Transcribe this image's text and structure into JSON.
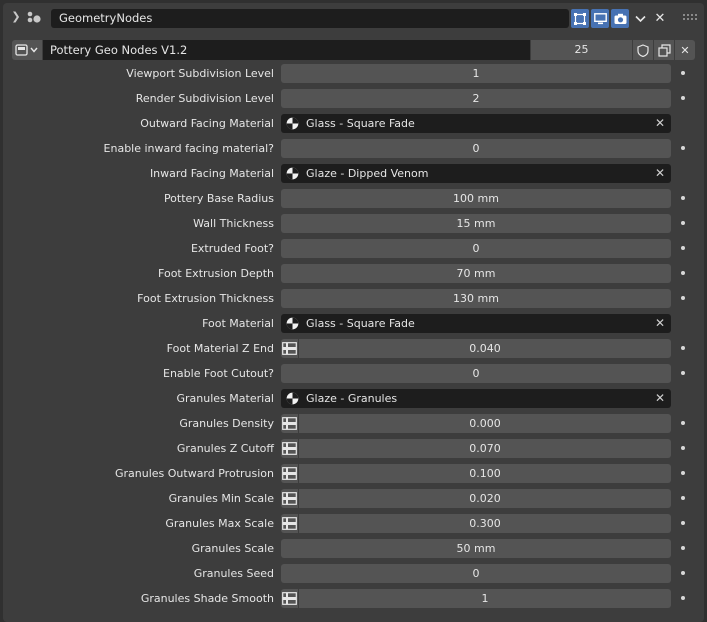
{
  "modifier": {
    "name": "GeometryNodes",
    "node_group": "Pottery Geo Nodes V1.2",
    "users": "25"
  },
  "colors": {
    "accent": "#4772b3",
    "panel": "#3d3d3d",
    "field": "#545454",
    "dark_field": "#1d1d1d"
  },
  "inputs": [
    {
      "label": "Viewport Subdivision Level",
      "kind": "value",
      "value": "1"
    },
    {
      "label": "Render Subdivision Level",
      "kind": "value",
      "value": "2"
    },
    {
      "label": "Outward Facing Material",
      "kind": "material",
      "value": "Glass - Square Fade"
    },
    {
      "label": "Enable inward facing material?",
      "kind": "value",
      "value": "0"
    },
    {
      "label": "Inward Facing Material",
      "kind": "material",
      "value": "Glaze - Dipped Venom"
    },
    {
      "label": "Pottery Base Radius",
      "kind": "value",
      "value": "100 mm"
    },
    {
      "label": "Wall Thickness",
      "kind": "value",
      "value": "15 mm"
    },
    {
      "label": "Extruded Foot?",
      "kind": "value",
      "value": "0"
    },
    {
      "label": "Foot Extrusion Depth",
      "kind": "value",
      "value": "70 mm"
    },
    {
      "label": "Foot Extrusion Thickness",
      "kind": "value",
      "value": "130 mm"
    },
    {
      "label": "Foot Material",
      "kind": "material",
      "value": "Glass - Square Fade"
    },
    {
      "label": "Foot Material Z End",
      "kind": "attr",
      "value": "0.040"
    },
    {
      "label": "Enable Foot Cutout?",
      "kind": "value",
      "value": "0"
    },
    {
      "label": "Granules Material",
      "kind": "material",
      "value": "Glaze - Granules"
    },
    {
      "label": "Granules Density",
      "kind": "attr",
      "value": "0.000"
    },
    {
      "label": "Granules Z Cutoff",
      "kind": "attr",
      "value": "0.070"
    },
    {
      "label": "Granules Outward Protrusion",
      "kind": "attr",
      "value": "0.100"
    },
    {
      "label": "Granules Min Scale",
      "kind": "attr",
      "value": "0.020"
    },
    {
      "label": "Granules Max Scale",
      "kind": "attr",
      "value": "0.300"
    },
    {
      "label": "Granules Scale",
      "kind": "value",
      "value": "50 mm"
    },
    {
      "label": "Granules Seed",
      "kind": "value",
      "value": "0"
    },
    {
      "label": "Granules Shade Smooth",
      "kind": "attr",
      "value": "1"
    }
  ],
  "icons": [
    "chevron-down-icon",
    "geometry-nodes-icon",
    "edit-mode-icon",
    "viewport-icon",
    "render-icon",
    "dropdown-icon",
    "close-icon",
    "drag-handle-icon",
    "node-tree-icon",
    "fake-user-icon",
    "duplicate-icon",
    "material-icon",
    "attribute-toggle-icon",
    "keyframe-dot-icon"
  ]
}
